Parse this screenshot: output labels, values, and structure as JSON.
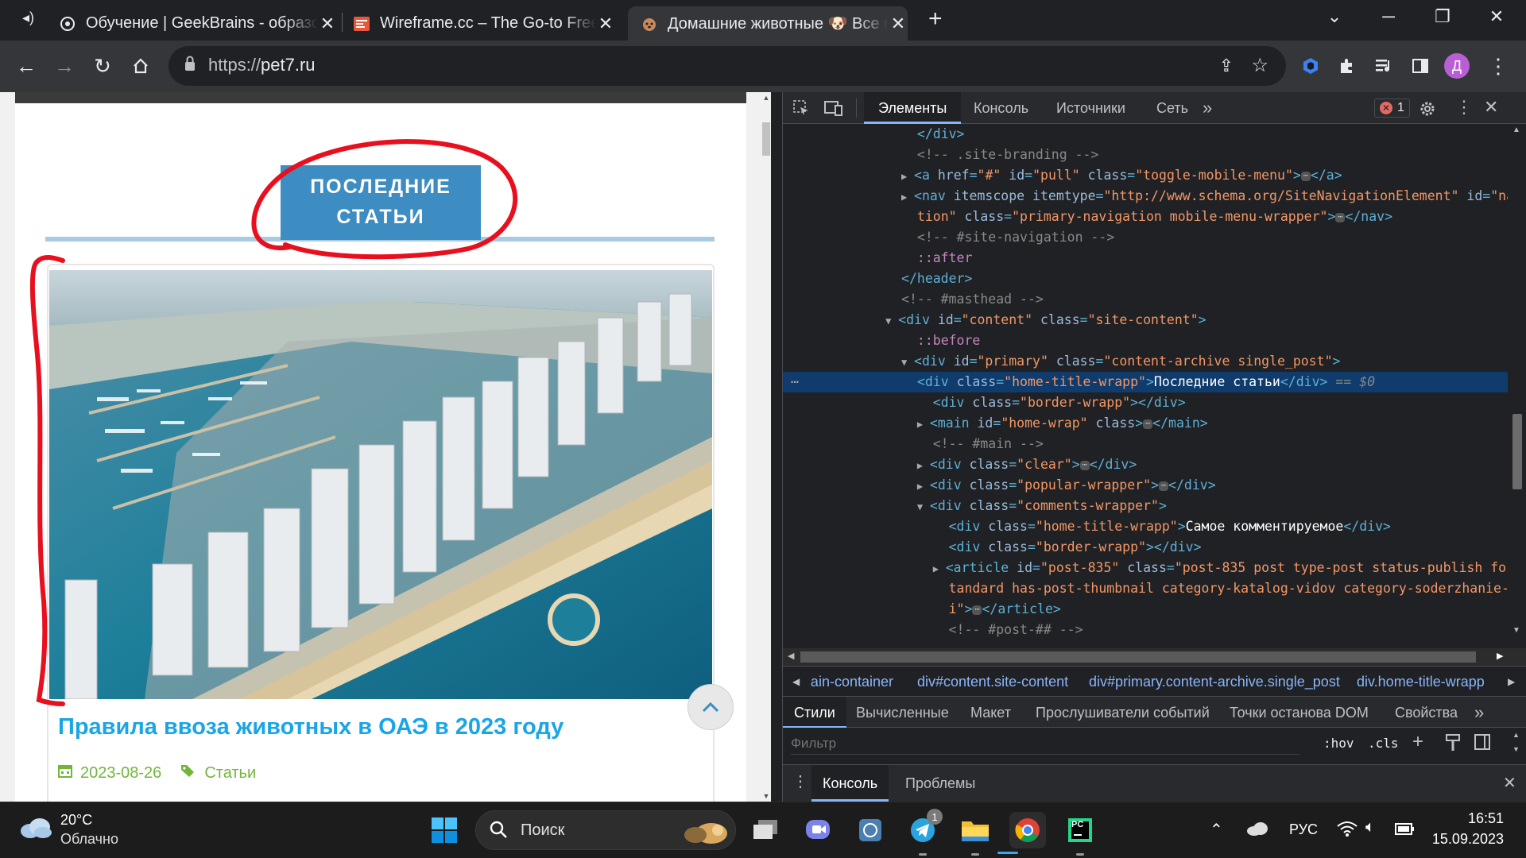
{
  "browser": {
    "tabs": [
      {
        "title": "Обучение | GeekBrains - образовательный портал",
        "icon": "geekbrains-icon"
      },
      {
        "title": "Wireframe.cc – The Go-to Free, Online Wireframe Tool",
        "icon": "wireframe-icon"
      },
      {
        "title": "Домашние животные 🐶 Все про домашних животных",
        "icon": "pet7-icon"
      }
    ],
    "url_prefix": "https://",
    "url_host": "pet7.ru",
    "new_tab_label": "+",
    "profile_letter": "Д"
  },
  "page": {
    "section_title_line1": "ПОСЛЕДНИЕ",
    "section_title_line2": "СТАТЬИ",
    "post_title": "Правила ввоза животных в ОАЭ в 2023 году",
    "post_date": "2023-08-26",
    "post_category": "Статьи"
  },
  "devtools": {
    "tabs": [
      "Элементы",
      "Консоль",
      "Источники",
      "Сеть"
    ],
    "more": "»",
    "error_count": "1",
    "subtabs": [
      "Стили",
      "Вычисленные",
      "Макет",
      "Прослушиватели событий",
      "Точки останова DOM",
      "Свойства"
    ],
    "filter_placeholder": "Фильтр",
    "hov": ":hov",
    "cls": ".cls",
    "drawer_tabs": [
      "Консоль",
      "Проблемы"
    ],
    "breadcrumbs": [
      "main-container",
      "div#content.site-content",
      "div#primary.content-archive.single_post",
      "div.home-title-wrapp"
    ],
    "dollar0": "== $0",
    "selected_text": "Последние статьи",
    "comment_text": "Самое комментируемое"
  },
  "taskbar": {
    "weather_temp": "20°C",
    "weather_desc": "Облачно",
    "search_label": "Поиск",
    "lang": "РУС",
    "time": "16:51",
    "date": "15.09.2023",
    "telegram_badge": "1",
    "pycharm_label": "PC"
  },
  "colors": {
    "accent_blue": "#3e8dc2",
    "link_blue": "#1aa5e6",
    "meta_green": "#71b63b",
    "annotation_red": "#e8101e"
  }
}
